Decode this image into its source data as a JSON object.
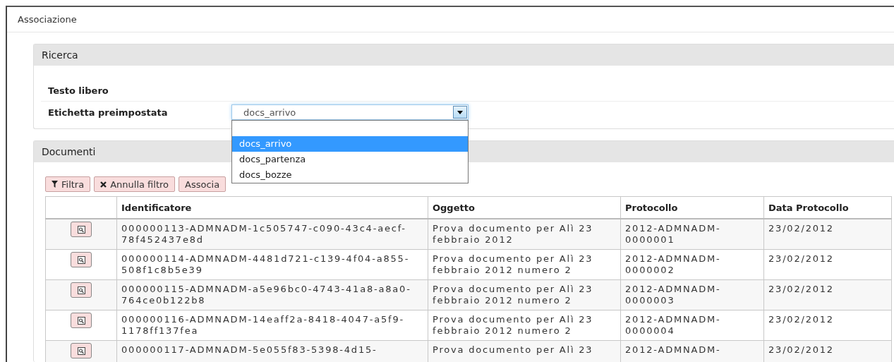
{
  "window": {
    "title": "Associazione"
  },
  "search_panel": {
    "title": "Ricerca",
    "fields": [
      {
        "kind": "text",
        "label": "Testo libero"
      },
      {
        "kind": "select",
        "label": "Etichetta preimpostata",
        "value": "docs_arrivo",
        "expanded": true,
        "options": [
          {
            "label": "docs_arrivo",
            "selected": true
          },
          {
            "label": "docs_partenza",
            "selected": false
          },
          {
            "label": "docs_bozze",
            "selected": false
          }
        ]
      }
    ]
  },
  "documents_panel": {
    "title": "Documenti",
    "buttons": [
      {
        "label": "Filtra"
      },
      {
        "label": "Annulla filtro"
      },
      {
        "label": "Associa"
      }
    ],
    "table": {
      "columns": [
        "Identificatore",
        "Oggetto",
        "Protocollo",
        "Data Protocollo"
      ],
      "rows": [
        {
          "cells": [
            "000000113-ADMNADM-1c505747-c090-43c4-aecf-78f452437e8d",
            "Prova documento per Alì 23 febbraio 2012",
            "2012-ADMNADM-0000001",
            "23/02/2012"
          ]
        },
        {
          "cells": [
            "000000114-ADMNADM-4481d721-c139-4f04-a855-508f1c8b5e39",
            "Prova documento per Alì 23 febbraio 2012 numero 2",
            "2012-ADMNADM-0000002",
            "23/02/2012"
          ]
        },
        {
          "cells": [
            "000000115-ADMNADM-a5e96bc0-4743-41a8-a8a0-764ce0b122b8",
            "Prova documento per Alì 23 febbraio 2012 numero 2",
            "2012-ADMNADM-0000003",
            "23/02/2012"
          ]
        },
        {
          "cells": [
            "000000116-ADMNADM-14eaff2a-8418-4047-a5f9-1178ff137fea",
            "Prova documento per Alì 23 febbraio 2012 numero 2",
            "2012-ADMNADM-0000004",
            "23/02/2012"
          ]
        },
        {
          "cells": [
            "000000117-ADMNADM-5e055f83-5398-4d15-",
            "Prova documento per Alì 23",
            "2012-ADMNADM-",
            "23/02/2012"
          ]
        }
      ]
    }
  }
}
